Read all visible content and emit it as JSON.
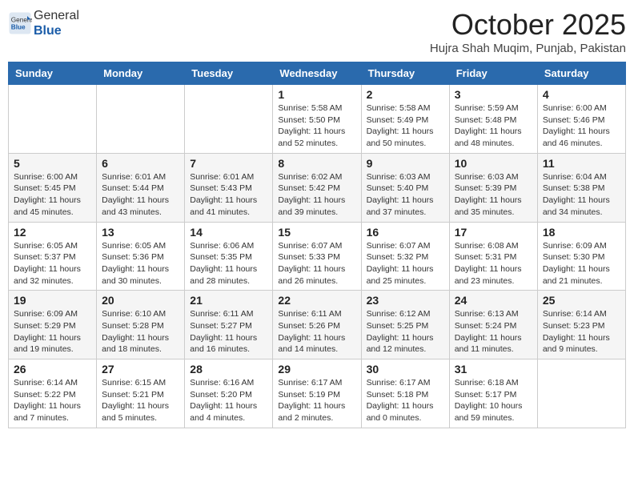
{
  "header": {
    "logo_general": "General",
    "logo_blue": "Blue",
    "month_title": "October 2025",
    "location": "Hujra Shah Muqim, Punjab, Pakistan"
  },
  "weekdays": [
    "Sunday",
    "Monday",
    "Tuesday",
    "Wednesday",
    "Thursday",
    "Friday",
    "Saturday"
  ],
  "weeks": [
    [
      {
        "day": "",
        "info": ""
      },
      {
        "day": "",
        "info": ""
      },
      {
        "day": "",
        "info": ""
      },
      {
        "day": "1",
        "info": "Sunrise: 5:58 AM\nSunset: 5:50 PM\nDaylight: 11 hours and 52 minutes."
      },
      {
        "day": "2",
        "info": "Sunrise: 5:58 AM\nSunset: 5:49 PM\nDaylight: 11 hours and 50 minutes."
      },
      {
        "day": "3",
        "info": "Sunrise: 5:59 AM\nSunset: 5:48 PM\nDaylight: 11 hours and 48 minutes."
      },
      {
        "day": "4",
        "info": "Sunrise: 6:00 AM\nSunset: 5:46 PM\nDaylight: 11 hours and 46 minutes."
      }
    ],
    [
      {
        "day": "5",
        "info": "Sunrise: 6:00 AM\nSunset: 5:45 PM\nDaylight: 11 hours and 45 minutes."
      },
      {
        "day": "6",
        "info": "Sunrise: 6:01 AM\nSunset: 5:44 PM\nDaylight: 11 hours and 43 minutes."
      },
      {
        "day": "7",
        "info": "Sunrise: 6:01 AM\nSunset: 5:43 PM\nDaylight: 11 hours and 41 minutes."
      },
      {
        "day": "8",
        "info": "Sunrise: 6:02 AM\nSunset: 5:42 PM\nDaylight: 11 hours and 39 minutes."
      },
      {
        "day": "9",
        "info": "Sunrise: 6:03 AM\nSunset: 5:40 PM\nDaylight: 11 hours and 37 minutes."
      },
      {
        "day": "10",
        "info": "Sunrise: 6:03 AM\nSunset: 5:39 PM\nDaylight: 11 hours and 35 minutes."
      },
      {
        "day": "11",
        "info": "Sunrise: 6:04 AM\nSunset: 5:38 PM\nDaylight: 11 hours and 34 minutes."
      }
    ],
    [
      {
        "day": "12",
        "info": "Sunrise: 6:05 AM\nSunset: 5:37 PM\nDaylight: 11 hours and 32 minutes."
      },
      {
        "day": "13",
        "info": "Sunrise: 6:05 AM\nSunset: 5:36 PM\nDaylight: 11 hours and 30 minutes."
      },
      {
        "day": "14",
        "info": "Sunrise: 6:06 AM\nSunset: 5:35 PM\nDaylight: 11 hours and 28 minutes."
      },
      {
        "day": "15",
        "info": "Sunrise: 6:07 AM\nSunset: 5:33 PM\nDaylight: 11 hours and 26 minutes."
      },
      {
        "day": "16",
        "info": "Sunrise: 6:07 AM\nSunset: 5:32 PM\nDaylight: 11 hours and 25 minutes."
      },
      {
        "day": "17",
        "info": "Sunrise: 6:08 AM\nSunset: 5:31 PM\nDaylight: 11 hours and 23 minutes."
      },
      {
        "day": "18",
        "info": "Sunrise: 6:09 AM\nSunset: 5:30 PM\nDaylight: 11 hours and 21 minutes."
      }
    ],
    [
      {
        "day": "19",
        "info": "Sunrise: 6:09 AM\nSunset: 5:29 PM\nDaylight: 11 hours and 19 minutes."
      },
      {
        "day": "20",
        "info": "Sunrise: 6:10 AM\nSunset: 5:28 PM\nDaylight: 11 hours and 18 minutes."
      },
      {
        "day": "21",
        "info": "Sunrise: 6:11 AM\nSunset: 5:27 PM\nDaylight: 11 hours and 16 minutes."
      },
      {
        "day": "22",
        "info": "Sunrise: 6:11 AM\nSunset: 5:26 PM\nDaylight: 11 hours and 14 minutes."
      },
      {
        "day": "23",
        "info": "Sunrise: 6:12 AM\nSunset: 5:25 PM\nDaylight: 11 hours and 12 minutes."
      },
      {
        "day": "24",
        "info": "Sunrise: 6:13 AM\nSunset: 5:24 PM\nDaylight: 11 hours and 11 minutes."
      },
      {
        "day": "25",
        "info": "Sunrise: 6:14 AM\nSunset: 5:23 PM\nDaylight: 11 hours and 9 minutes."
      }
    ],
    [
      {
        "day": "26",
        "info": "Sunrise: 6:14 AM\nSunset: 5:22 PM\nDaylight: 11 hours and 7 minutes."
      },
      {
        "day": "27",
        "info": "Sunrise: 6:15 AM\nSunset: 5:21 PM\nDaylight: 11 hours and 5 minutes."
      },
      {
        "day": "28",
        "info": "Sunrise: 6:16 AM\nSunset: 5:20 PM\nDaylight: 11 hours and 4 minutes."
      },
      {
        "day": "29",
        "info": "Sunrise: 6:17 AM\nSunset: 5:19 PM\nDaylight: 11 hours and 2 minutes."
      },
      {
        "day": "30",
        "info": "Sunrise: 6:17 AM\nSunset: 5:18 PM\nDaylight: 11 hours and 0 minutes."
      },
      {
        "day": "31",
        "info": "Sunrise: 6:18 AM\nSunset: 5:17 PM\nDaylight: 10 hours and 59 minutes."
      },
      {
        "day": "",
        "info": ""
      }
    ]
  ]
}
